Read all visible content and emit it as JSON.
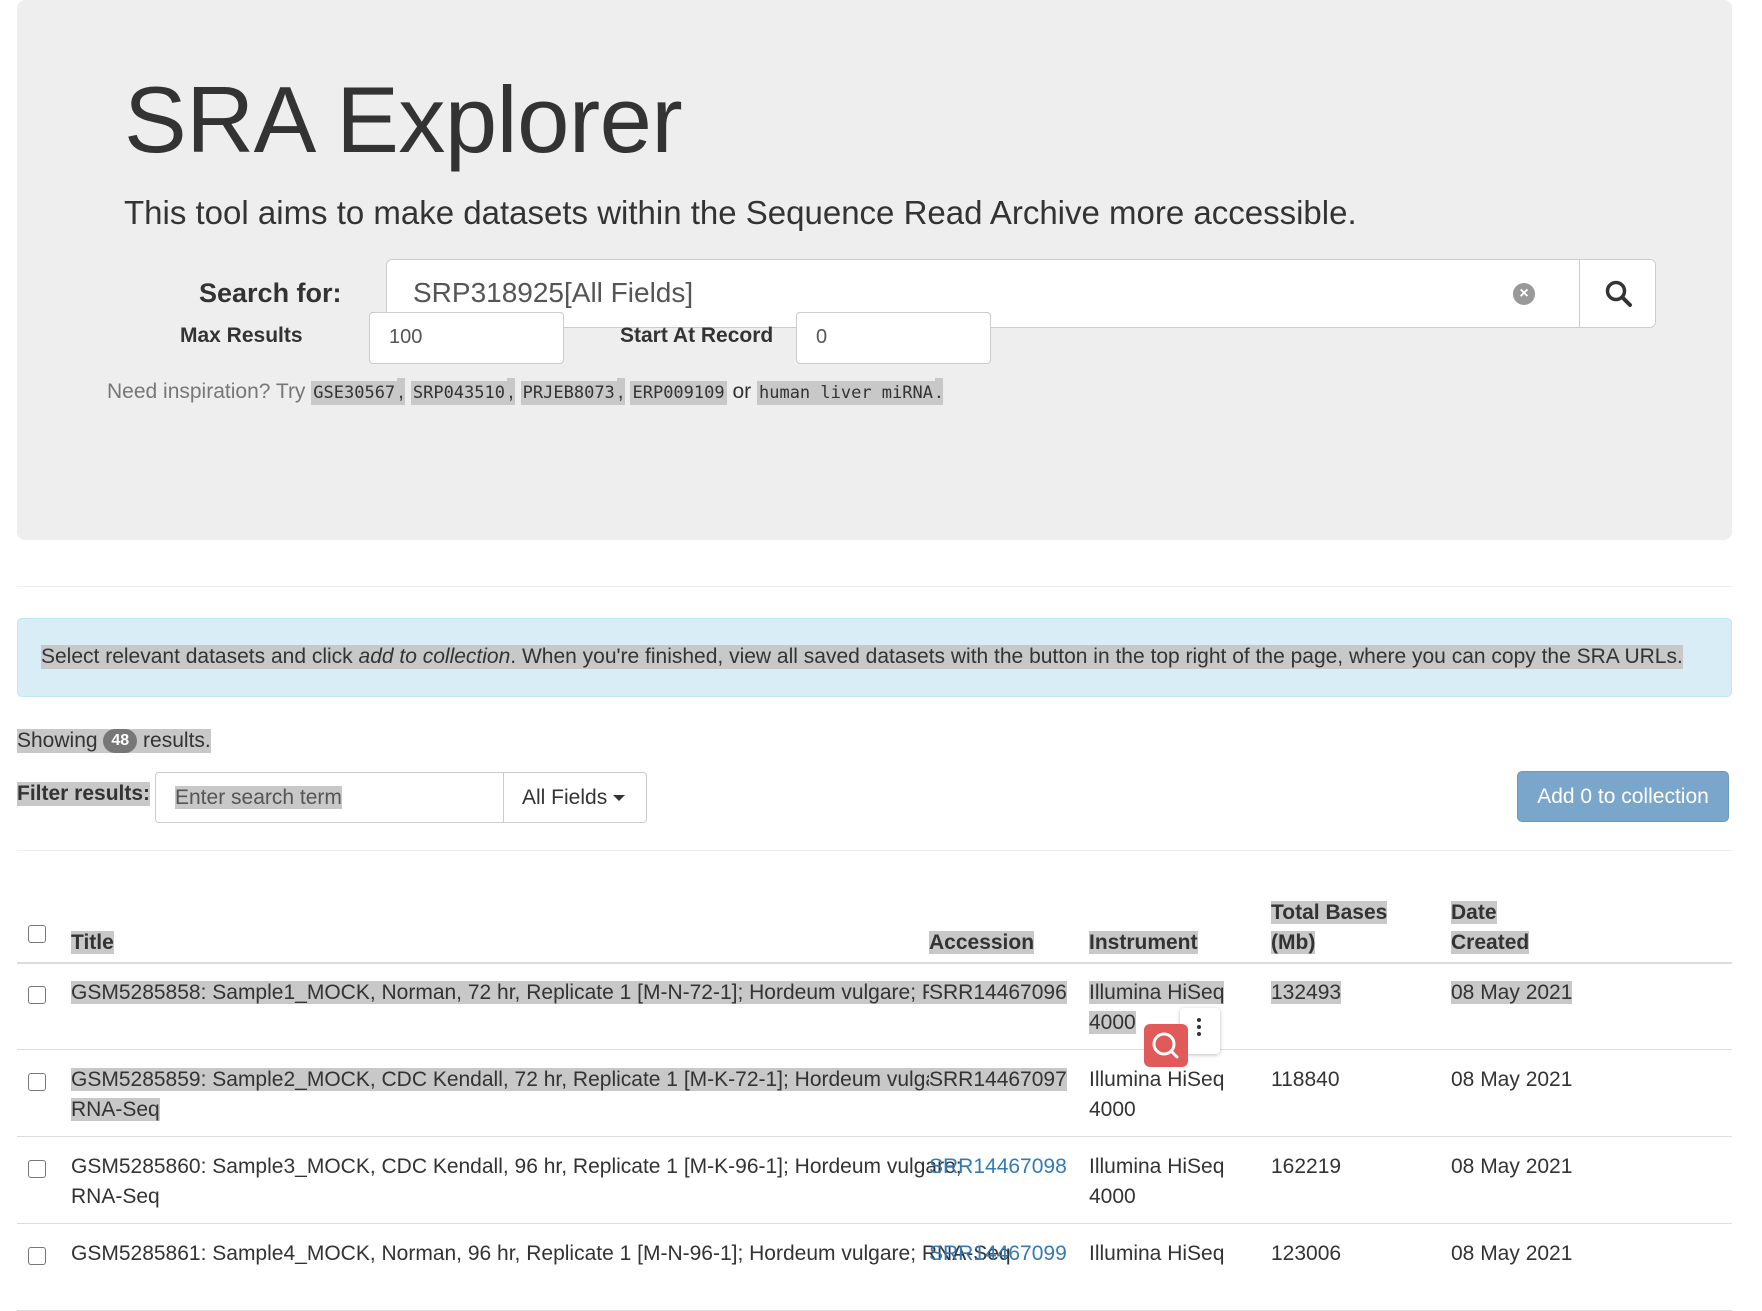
{
  "header": {
    "title": "SRA Explorer",
    "lead": "This tool aims to make datasets within the Sequence Read Archive more accessible."
  },
  "search": {
    "label": "Search for:",
    "value": "SRP318925[All Fields]",
    "max_results_label": "Max Results",
    "max_results_value": "100",
    "start_label": "Start At Record",
    "start_value": "0"
  },
  "inspiration": {
    "prefix": "Need inspiration? Try",
    "examples": [
      "GSE30567",
      "SRP043510",
      "PRJEB8073",
      "ERP009109",
      "human liver miRNA"
    ],
    "comma": ",",
    "or": "or",
    "period": "."
  },
  "alert": {
    "before": "Select relevant datasets and click ",
    "emphasis": "add to collection",
    "after": ". When you're finished, view all saved datasets with the button in the top right of the page, where you can copy the SRA URLs."
  },
  "results": {
    "showing_prefix": "Showing",
    "count": "48",
    "showing_suffix": "results.",
    "filter_label": "Filter results:",
    "filter_placeholder": "Enter search term",
    "filter_field": "All Fields",
    "add_button": "Add 0 to collection"
  },
  "table": {
    "headers": {
      "title": "Title",
      "accession": "Accession",
      "instrument": "Instrument",
      "total_bases_line1": "Total Bases",
      "total_bases_line2": "(Mb)",
      "date_line1": "Date",
      "date_line2": "Created"
    },
    "rows": [
      {
        "title": "GSM5285858: Sample1_MOCK, Norman, 72 hr, Replicate 1 [M-N-72-1]; Hordeum vulgare; RNA-Seq",
        "accession": "SRR14467096",
        "instrument_line1": "Illumina HiSeq",
        "instrument_line2": "4000",
        "bases": "132493",
        "date": "08 May 2021"
      },
      {
        "title_line1": "GSM5285859: Sample2_MOCK, CDC Kendall, 72 hr, Replicate 1 [M-K-72-1]; Hordeum vulgare;",
        "title_line2": "RNA-Seq",
        "accession": "SRR14467097",
        "instrument_line1": "Illumina HiSeq",
        "instrument_line2": "4000",
        "bases": "118840",
        "date": "08 May 2021"
      },
      {
        "title_line1": "GSM5285860: Sample3_MOCK, CDC Kendall, 96 hr, Replicate 1 [M-K-96-1]; Hordeum vulgare;",
        "title_line2": "RNA-Seq",
        "accession": "SRR14467098",
        "instrument_line1": "Illumina HiSeq",
        "instrument_line2": "4000",
        "bases": "162219",
        "date": "08 May 2021"
      },
      {
        "title": "GSM5285861: Sample4_MOCK, Norman, 96 hr, Replicate 1 [M-N-96-1]; Hordeum vulgare; RNA-Seq",
        "accession": "SRR14467099",
        "instrument_line1": "Illumina HiSeq",
        "bases": "123006",
        "date": "08 May 2021"
      }
    ]
  },
  "colors": {
    "jumbotron": "#eeeeee",
    "alert_bg": "#d9edf7",
    "link": "#337ab7",
    "primary_button": "#7ba6cc",
    "selection": "#c8c8c8"
  },
  "icons": [
    "search-icon",
    "clear-icon",
    "caret-down-icon",
    "more-vertical-icon",
    "search-extension-icon"
  ]
}
